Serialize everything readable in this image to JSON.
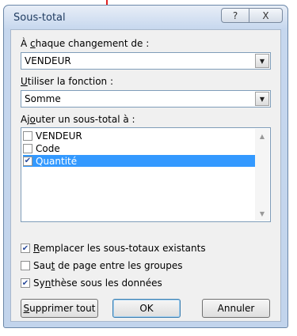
{
  "window": {
    "title": "Sous-total",
    "help_glyph": "?",
    "close_glyph": "X"
  },
  "group": {
    "label_pre": "À ",
    "label_ul": "c",
    "label_post": "haque changement de :",
    "value": "VENDEUR"
  },
  "function": {
    "label_ul": "U",
    "label_post": "tiliser la fonction :",
    "value": "Somme"
  },
  "subtotal": {
    "label_pre": "Aj",
    "label_ul": "o",
    "label_post": "uter un sous-total à :",
    "items": [
      {
        "label": "VENDEUR",
        "checked": false,
        "selected": false
      },
      {
        "label": "Code",
        "checked": false,
        "selected": false
      },
      {
        "label": "Quantité",
        "checked": true,
        "selected": true
      }
    ]
  },
  "options": {
    "replace": {
      "ul": "R",
      "post": "emplacer les sous-totaux existants",
      "checked": true
    },
    "pagebreak": {
      "pre": "Sau",
      "ul": "t",
      "post": " de page entre les groupes",
      "checked": false
    },
    "summary": {
      "pre": "Sy",
      "ul": "n",
      "post": "thèse sous les données",
      "checked": true
    }
  },
  "buttons": {
    "remove_ul": "S",
    "remove_post": "upprimer tout",
    "ok": "OK",
    "cancel": "Annuler"
  },
  "colors": {
    "annotation_arrow": "#e02020",
    "selection": "#3399ff"
  }
}
